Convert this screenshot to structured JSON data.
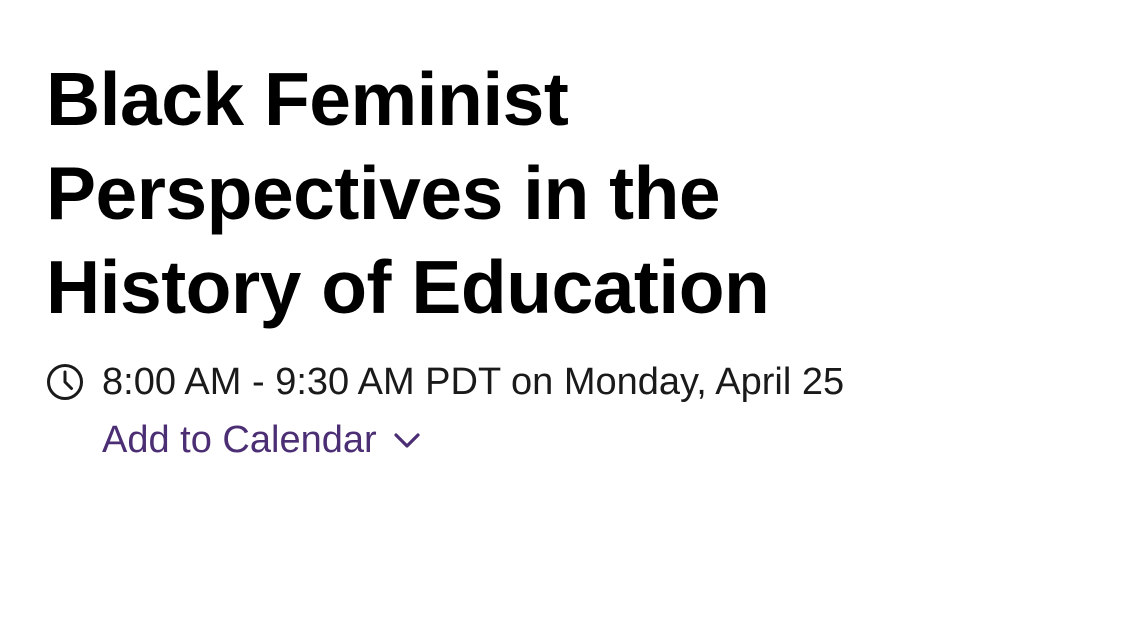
{
  "event": {
    "title": "Black Feminist Perspectives in the History of Education",
    "time_text": "8:00 AM - 9:30 AM PDT on Monday, April 25",
    "add_to_calendar_label": "Add to Calendar"
  },
  "icons": {
    "time": "clock-icon",
    "calendar_toggle": "chevron-down-icon"
  },
  "colors": {
    "title": "#000000",
    "body_text": "#1a1a1a",
    "link": "#4b2e73",
    "background": "#ffffff"
  }
}
